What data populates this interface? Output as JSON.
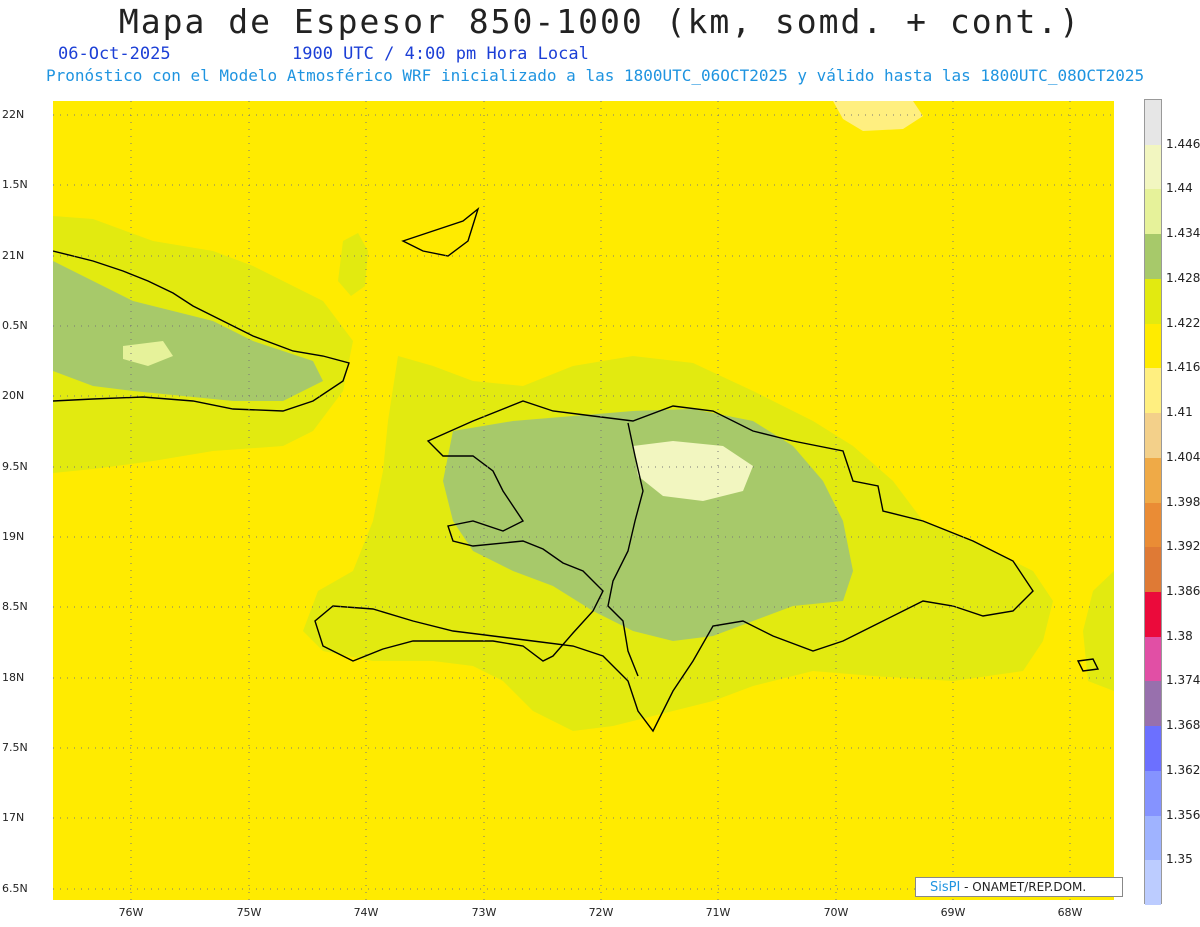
{
  "header": {
    "title": "Mapa de Espesor 850-1000 (km, somd. + cont.)",
    "date": "06-Oct-2025",
    "time": "1900 UTC / 4:00 pm Hora Local",
    "subtitle": "Pronóstico con el Modelo Atmosférico WRF inicializado a las 1800UTC_06OCT2025 y válido hasta las  1800UTC_08OCT2025"
  },
  "axes": {
    "lat_labels": [
      "22N",
      "1.5N",
      "21N",
      "0.5N",
      "20N",
      "9.5N",
      "19N",
      "8.5N",
      "18N",
      "7.5N",
      "17N",
      "6.5N"
    ],
    "lon_labels": [
      "76W",
      "75W",
      "74W",
      "73W",
      "72W",
      "71W",
      "70W",
      "69W",
      "68W"
    ]
  },
  "colorbar": {
    "labels": [
      "1.446",
      "1.44",
      "1.434",
      "1.428",
      "1.422",
      "1.416",
      "1.41",
      "1.404",
      "1.398",
      "1.392",
      "1.386",
      "1.38",
      "1.374",
      "1.368",
      "1.362",
      "1.356",
      "1.35"
    ],
    "colors": [
      "#e6e6e6",
      "#f2f6c0",
      "#e6f29a",
      "#a7c96a",
      "#e2ea10",
      "#ffeb00",
      "#ffef80",
      "#f3d08a",
      "#efaa47",
      "#ea8c35",
      "#df7a35",
      "#eb0a3b",
      "#e14fa5",
      "#9870ad",
      "#6c70ff",
      "#8593ff",
      "#9fb3ff",
      "#bcccff"
    ]
  },
  "credit": {
    "brand": "SisPI",
    "text": "- ONAMET/REP.DOM."
  }
}
